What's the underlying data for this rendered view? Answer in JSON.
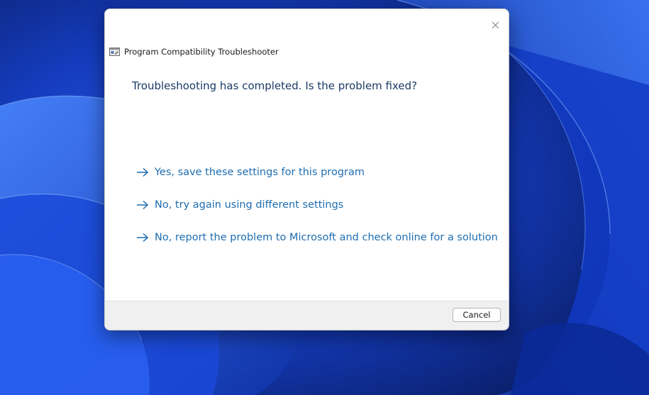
{
  "dialog": {
    "title": "Program Compatibility Troubleshooter",
    "question": "Troubleshooting has completed. Is the problem fixed?",
    "options": [
      {
        "label": "Yes, save these settings for this program",
        "icon": "arrow-right-icon"
      },
      {
        "label": "No, try again using different settings",
        "icon": "arrow-right-icon"
      },
      {
        "label": "No, report the problem to Microsoft and check online for a solution",
        "icon": "arrow-right-icon"
      }
    ],
    "cancel_label": "Cancel",
    "close_icon": "close-icon",
    "app_icon": "troubleshooter-icon"
  },
  "colors": {
    "question_text": "#1c3a66",
    "option_link": "#1e6db0",
    "footer_bg": "#f0f0f0",
    "wallpaper_base": "#0a1f6b"
  }
}
